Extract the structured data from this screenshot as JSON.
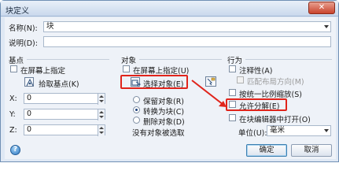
{
  "window": {
    "title": "块定义",
    "close_symbol": "✕"
  },
  "name_field": {
    "label": "名称(N):",
    "value": "块"
  },
  "description_field": {
    "label": "说明(D):",
    "value": ""
  },
  "base_point": {
    "title": "基点",
    "specify_on_screen": "在屏幕上指定",
    "pick_button": "拾取基点(K)",
    "x_label": "X:",
    "x_value": "0",
    "y_label": "Y:",
    "y_value": "0",
    "z_label": "Z:",
    "z_value": "0"
  },
  "objects": {
    "title": "对象",
    "specify_on_screen": "在屏幕上指定(U)",
    "select_objects_button": "选择对象(E)",
    "retain": "保留对象(R)",
    "convert_to_block": "转换为块(C)",
    "delete": "删除对象(D)",
    "status": "没有对象被选取"
  },
  "behavior": {
    "title": "行为",
    "annotative": "注释性(A)",
    "match_orientation": "匹配布局方向(M)",
    "scale_uniformly": "按统一比例缩放(S)",
    "allow_explode": "允许分解(E)",
    "open_in_editor": "在块编辑器中打开(O)",
    "unit_label": "单位(U):",
    "unit_value": "毫米"
  },
  "buttons": {
    "ok": "确定",
    "cancel": "取消",
    "help": "?"
  },
  "colors": {
    "highlight": "#e0241b",
    "accent": "#3c7fb1"
  }
}
